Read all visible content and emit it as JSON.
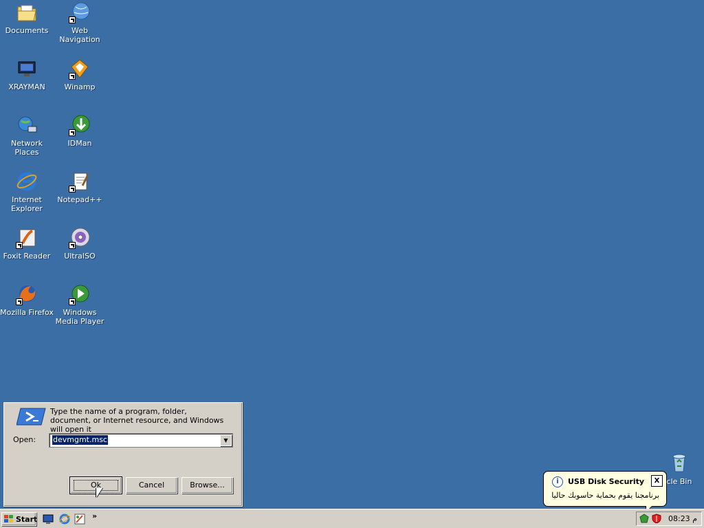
{
  "desktop": {
    "icons": [
      {
        "label": "Documents",
        "icon": "documents-folder-icon"
      },
      {
        "label": "Web Navigation",
        "icon": "web-navigation-icon"
      },
      {
        "label": "XRAYMAN",
        "icon": "xrayman-icon"
      },
      {
        "label": "Winamp",
        "icon": "winamp-icon"
      },
      {
        "label": "Network Places",
        "icon": "network-places-icon"
      },
      {
        "label": "IDMan",
        "icon": "idman-icon"
      },
      {
        "label": "Internet Explorer",
        "icon": "internet-explorer-icon"
      },
      {
        "label": "Notepad++",
        "icon": "notepad-plus-plus-icon"
      },
      {
        "label": "Foxit Reader",
        "icon": "foxit-reader-icon"
      },
      {
        "label": "UltraISO",
        "icon": "ultraiso-icon"
      },
      {
        "label": "Mozilla Firefox",
        "icon": "firefox-icon"
      },
      {
        "label": "Windows Media Player",
        "icon": "windows-media-player-icon"
      }
    ],
    "recycle_bin": {
      "label": "Recycle Bin",
      "visible_label": "cle Bin",
      "icon": "recycle-bin-icon"
    }
  },
  "run_dialog": {
    "description": "Type the name of a program, folder, document, or Internet resource, and Windows will open it",
    "open_label": "Open:",
    "open_value": "devmgmt.msc",
    "ok_label": "Ok",
    "cancel_label": "Cancel",
    "browse_label": "Browse..."
  },
  "balloon": {
    "title": "USB Disk Security",
    "message": "برنامجنا يقوم بحماية حاسوبك حاليا",
    "close_label": "X"
  },
  "taskbar": {
    "start_label": "Start",
    "quick_launch": [
      "show-desktop-icon",
      "internet-explorer-icon",
      "paint-icon"
    ],
    "chevron": "»",
    "clock": "08:23 م"
  },
  "colors": {
    "desktop": "#3a6ea5",
    "chrome": "#d4d0c8",
    "selection": "#0a246a",
    "tooltip": "#ffffe1"
  }
}
